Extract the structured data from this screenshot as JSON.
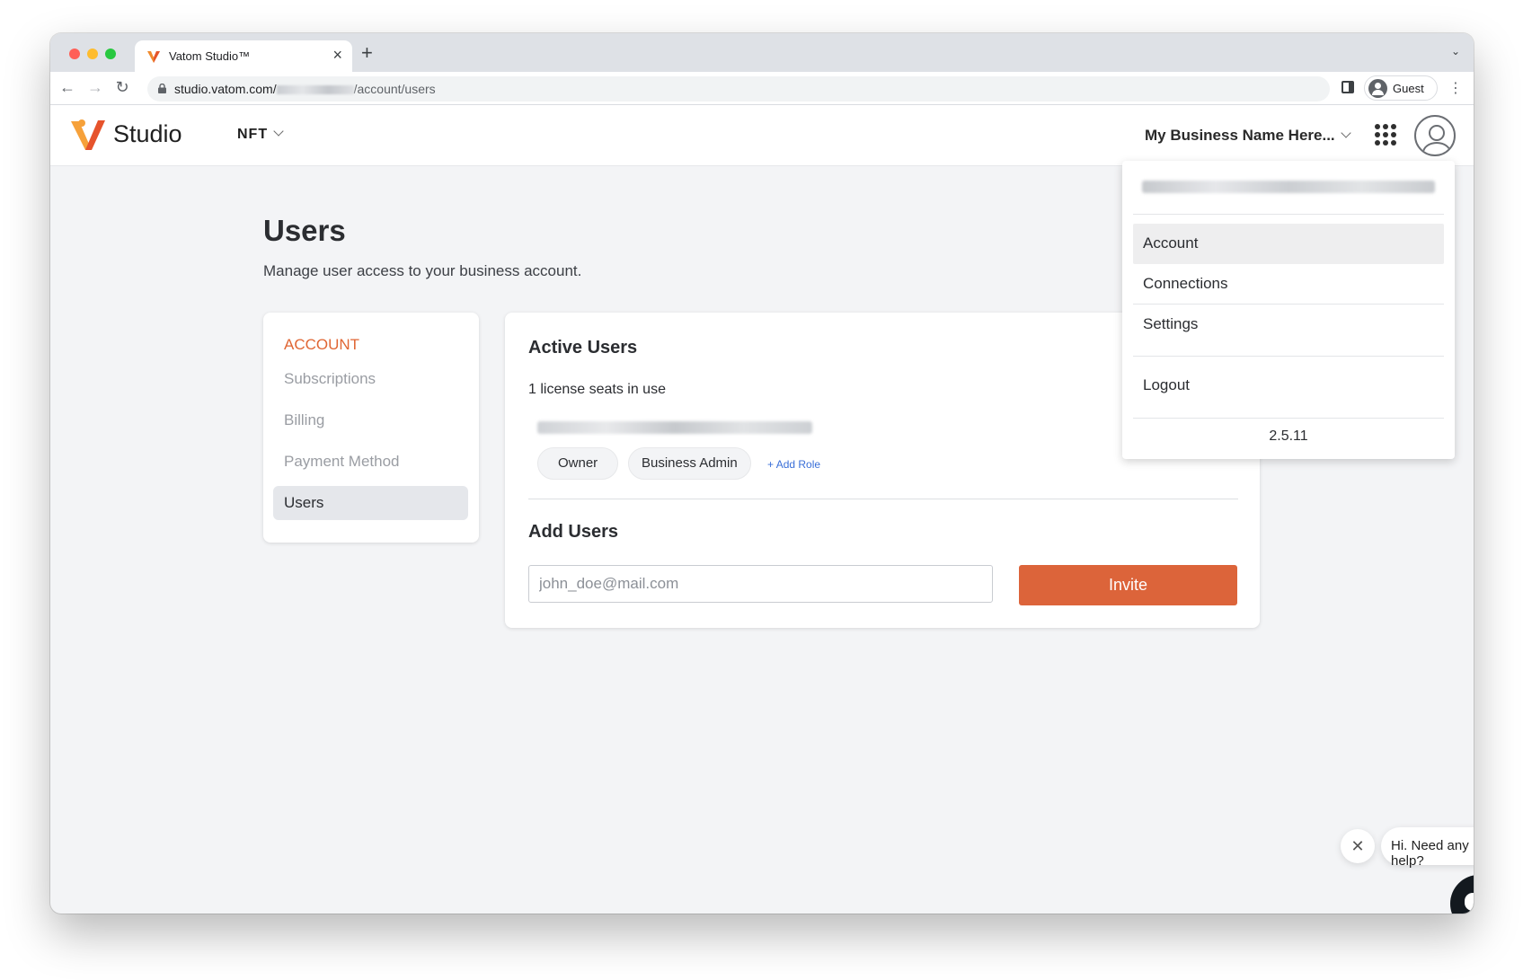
{
  "browser": {
    "tab_title": "Vatom Studio™",
    "url_host": "studio.vatom.com/",
    "url_path": "/account/users",
    "profile_label": "Guest"
  },
  "header": {
    "logo_text": "Studio",
    "product_menu": "NFT",
    "business_name": "My Business Name Here..."
  },
  "page": {
    "title": "Users",
    "subtitle": "Manage user access to your business account."
  },
  "sidebar": {
    "heading": "ACCOUNT",
    "items": [
      {
        "label": "Subscriptions",
        "active": false
      },
      {
        "label": "Billing",
        "active": false
      },
      {
        "label": "Payment Method",
        "active": false
      },
      {
        "label": "Users",
        "active": true
      }
    ]
  },
  "active_users": {
    "title": "Active Users",
    "seats_text": "1 license seats in use",
    "roles": [
      "Owner",
      "Business Admin"
    ],
    "add_role_label": "Add Role"
  },
  "add_users": {
    "title": "Add Users",
    "email_placeholder": "john_doe@mail.com",
    "invite_label": "Invite"
  },
  "profile_menu": {
    "items": [
      "Account",
      "Connections",
      "Settings"
    ],
    "logout_label": "Logout",
    "version": "2.5.11"
  },
  "help_widget": {
    "message": "Hi. Need any help?"
  },
  "colors": {
    "brand_orange": "#dc643a",
    "accent_heading": "#e06634",
    "link_blue": "#3a6fd8",
    "launcher_dark": "#13191f"
  }
}
